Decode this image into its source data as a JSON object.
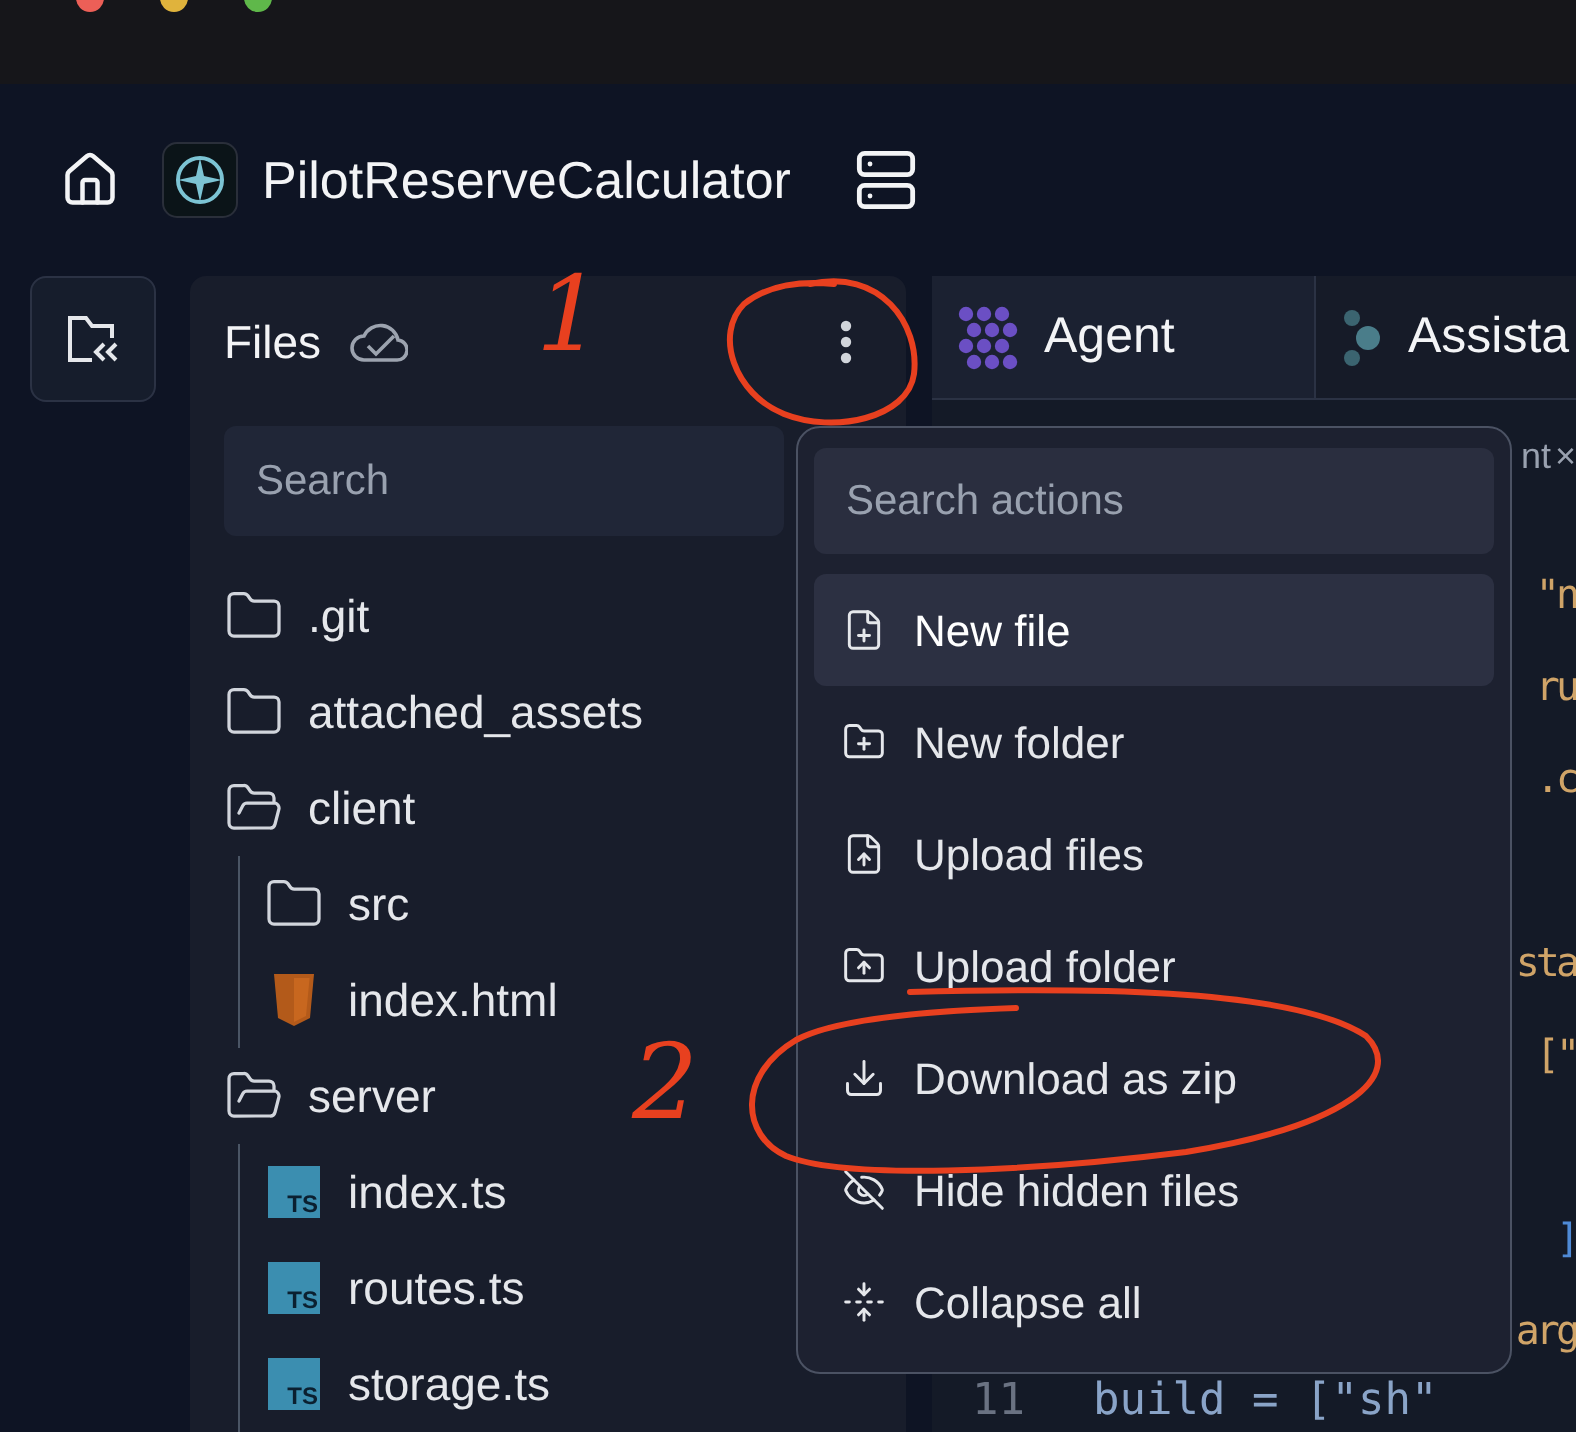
{
  "header": {
    "title": "PilotReserveCalculator"
  },
  "files_panel": {
    "title": "Files",
    "search": {
      "placeholder": "Search"
    },
    "tree": [
      {
        "kind": "folder",
        "name": ".git",
        "expanded": false
      },
      {
        "kind": "folder",
        "name": "attached_assets",
        "expanded": false
      },
      {
        "kind": "folder",
        "name": "client",
        "expanded": true,
        "children": [
          {
            "kind": "folder",
            "name": "src",
            "expanded": false
          },
          {
            "kind": "html",
            "name": "index.html"
          }
        ]
      },
      {
        "kind": "folder",
        "name": "server",
        "expanded": true,
        "children": [
          {
            "kind": "ts",
            "badge": "TS",
            "name": "index.ts"
          },
          {
            "kind": "ts",
            "badge": "TS",
            "name": "routes.ts"
          },
          {
            "kind": "ts",
            "badge": "TS",
            "name": "storage.ts"
          }
        ]
      }
    ]
  },
  "actions_menu": {
    "search": {
      "placeholder": "Search actions"
    },
    "items": [
      {
        "kind": "new-file",
        "label": "New file",
        "selected": true
      },
      {
        "kind": "new-folder",
        "label": "New folder",
        "selected": false
      },
      {
        "kind": "upload-files",
        "label": "Upload files",
        "selected": false
      },
      {
        "kind": "upload-folder",
        "label": "Upload folder",
        "selected": false
      },
      {
        "kind": "download",
        "label": "Download as zip",
        "selected": false
      },
      {
        "kind": "hide",
        "label": "Hide hidden files",
        "selected": false
      },
      {
        "kind": "collapse",
        "label": "Collapse all",
        "selected": false
      }
    ]
  },
  "right_panel": {
    "tabs": [
      {
        "kind": "agent",
        "label": "Agent",
        "selected": true
      },
      {
        "kind": "assistant",
        "label": "Assista",
        "selected": false
      }
    ],
    "editor_tab": {
      "label": "nt",
      "close": "×"
    },
    "code_lines": [
      {
        "kind": "code",
        "text": "\"n"
      },
      {
        "kind": "code",
        "text": "ru"
      },
      {
        "kind": "code",
        "text": ".c"
      },
      {
        "kind": "blank"
      },
      {
        "kind": "code",
        "text": "sta"
      },
      {
        "kind": "code",
        "text": "[\""
      },
      {
        "kind": "blank"
      },
      {
        "kind": "bracket",
        "text": "]"
      },
      {
        "kind": "code",
        "text": "arg"
      },
      {
        "kind": "numbered",
        "number": "11",
        "text": "build = [\"sh\""
      }
    ]
  },
  "annotations": [
    {
      "kind": "number",
      "text": "1"
    },
    {
      "kind": "number",
      "text": "2"
    }
  ]
}
